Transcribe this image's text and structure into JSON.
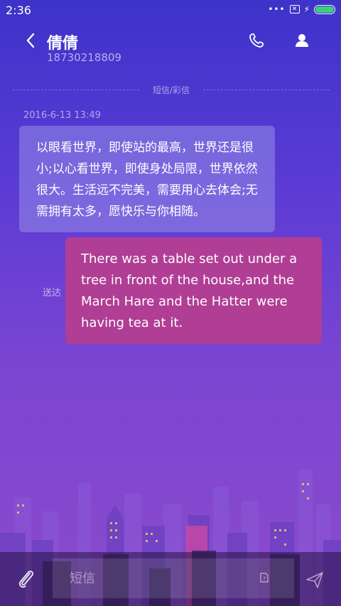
{
  "status_bar": {
    "time": "2:36",
    "battery_color": "#3ad07a"
  },
  "header": {
    "contact_name": "倩倩",
    "contact_number": "18730218809"
  },
  "divider": {
    "label": "短信/彩信"
  },
  "conversation": {
    "timestamp": "2016-6-13 13:49",
    "incoming_message": "以眼看世界，即使站的最高，世界还是很小;以心看世界，即使身处局限，世界依然很大。生活远不完美，需要用心去体会;无需拥有太多，愿快乐与你相随。",
    "sent_status": "送达",
    "outgoing_message": "There was a table set out under a tree in front of the house,and the March Hare and the Hatter were having tea at it."
  },
  "composer": {
    "placeholder": "短信"
  },
  "colors": {
    "outgoing_bubble": "#b03e94",
    "incoming_bubble": "#968ce6"
  },
  "icons": [
    "back-arrow-icon",
    "phone-icon",
    "person-icon",
    "paperclip-icon",
    "sim-card-icon",
    "send-icon"
  ]
}
